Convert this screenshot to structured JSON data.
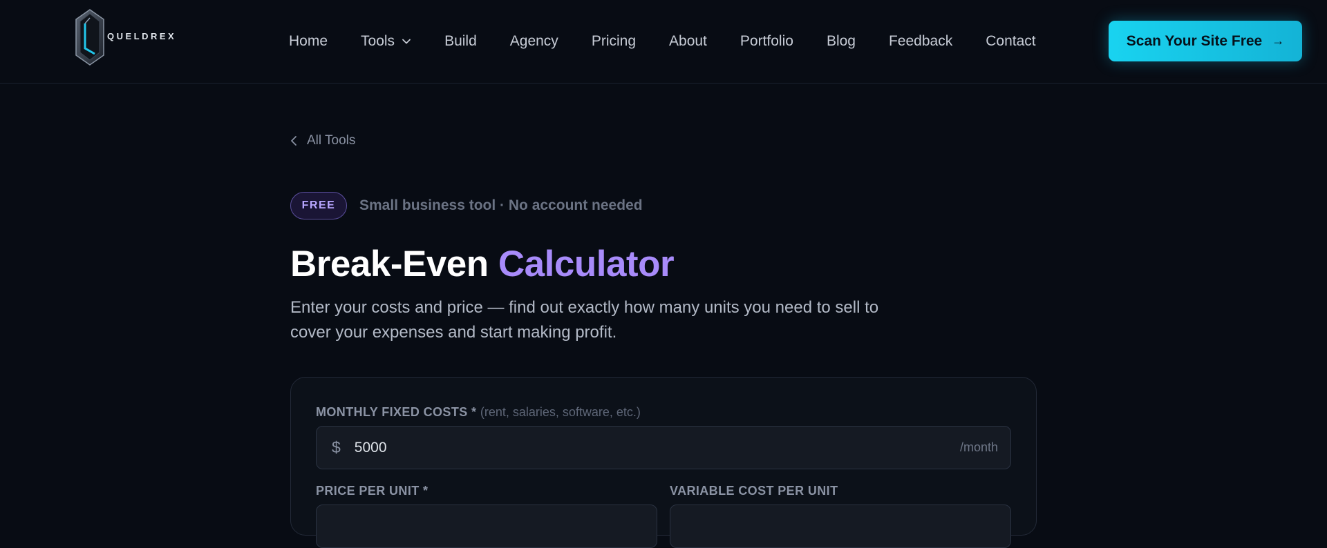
{
  "brand": {
    "name": "QUELDREX"
  },
  "nav": {
    "items": [
      "Home",
      "Tools",
      "Build",
      "Agency",
      "Pricing",
      "About",
      "Portfolio",
      "Blog",
      "Feedback",
      "Contact"
    ]
  },
  "cta": {
    "label": "Scan Your Site Free",
    "icon": "arrow-right-icon"
  },
  "back_link": {
    "label": "All Tools",
    "icon": "chevron-left-icon"
  },
  "badge": {
    "label": "FREE",
    "note": "Small business tool · No account needed"
  },
  "hero": {
    "title_main": "Break-Even",
    "title_accent": "Calculator",
    "description": "Enter your costs and price — find out exactly how many units you need to sell to cover your expenses and start making profit."
  },
  "form": {
    "fixed_costs": {
      "label": "MONTHLY FIXED COSTS *",
      "hint": "(rent, salaries, software, etc.)",
      "prefix": "$",
      "value": "5000",
      "suffix": "/month"
    },
    "price_per_unit": {
      "label": "PRICE PER UNIT *"
    },
    "variable_cost": {
      "label": "VARIABLE COST PER UNIT"
    }
  },
  "colors": {
    "background": "#080c14",
    "accent_purple": "#a88bfa",
    "cta_cyan": "#19d3f0"
  }
}
